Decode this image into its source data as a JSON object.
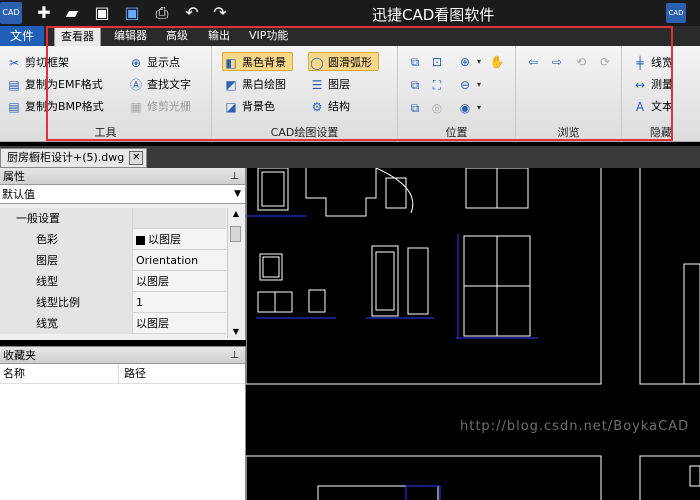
{
  "titlebar": {
    "logo_text": "CAD",
    "title": "迅捷CAD看图软件",
    "quick_icons": [
      "new-icon",
      "open-folder-icon",
      "save-icon",
      "save-as-icon",
      "print-icon",
      "undo-icon",
      "redo-icon"
    ]
  },
  "menu": {
    "file": "文件",
    "tabs": [
      "查看器",
      "编辑器",
      "高级",
      "输出",
      "VIP功能"
    ],
    "active": "查看器"
  },
  "ribbon": {
    "tools": {
      "label": "工具",
      "clip_frame": "剪切框架",
      "copy_emf": "复制为EMF格式",
      "copy_bmp": "复制为BMP格式",
      "show_points": "显示点",
      "find_text": "查找文字",
      "trim_raster": "修剪光栅"
    },
    "draw_settings": {
      "label": "CAD绘图设置",
      "black_bg": "黑色背景",
      "bw_draw": "黑白绘图",
      "bg_color": "背景色",
      "smooth_arc": "圆滑弧形",
      "layers": "图层",
      "structure": "结构"
    },
    "position": {
      "label": "位置"
    },
    "browse": {
      "label": "浏览"
    },
    "hide": {
      "label": "隐藏",
      "linewidth": "线宽",
      "measure": "测量",
      "text": "文本"
    }
  },
  "document": {
    "tab_name": "厨房橱柜设计+(5).dwg",
    "close_symbol": "✕"
  },
  "properties": {
    "header": "属性",
    "selector_value": "默认值",
    "section": "一般设置",
    "section_toggle": "−",
    "rows": [
      {
        "name": "色彩",
        "value": "以图层"
      },
      {
        "name": "图层",
        "value": "Orientation"
      },
      {
        "name": "线型",
        "value": "以图层"
      },
      {
        "name": "线型比例",
        "value": "1"
      },
      {
        "name": "线宽",
        "value": "以图层"
      }
    ]
  },
  "favorites": {
    "header": "收藏夹",
    "col_name": "名称",
    "col_path": "路径"
  },
  "canvas": {
    "watermark": "http://blog.csdn.net/BoykaCAD"
  },
  "colors": {
    "highlight": "#e0323a",
    "file_tab": "#1f5fb8",
    "toggle_active": "#f8d88a",
    "canvas_line": "#ffffff",
    "canvas_blue": "#2a3cff"
  }
}
